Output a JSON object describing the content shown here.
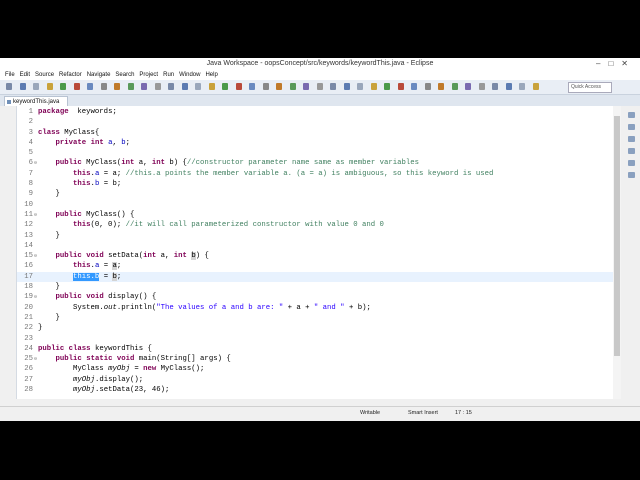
{
  "window": {
    "title": "Java Workspace - oopsConcept/src/keywords/keywordThis.java - Eclipse"
  },
  "menu": [
    "File",
    "Edit",
    "Source",
    "Refactor",
    "Navigate",
    "Search",
    "Project",
    "Run",
    "Window",
    "Help"
  ],
  "toolbar": {
    "quick_access": "Quick Access"
  },
  "editor_tab": {
    "label": "keywordThis.java"
  },
  "code": [
    {
      "n": "1",
      "fold": false,
      "current": false,
      "segs": [
        [
          "kw",
          "package"
        ],
        [
          "",
          "  keywords;"
        ]
      ]
    },
    {
      "n": "2",
      "fold": false,
      "current": false,
      "segs": []
    },
    {
      "n": "3",
      "fold": false,
      "current": false,
      "segs": [
        [
          "kw",
          "class"
        ],
        [
          "",
          " MyClass{"
        ]
      ]
    },
    {
      "n": "4",
      "fold": false,
      "current": false,
      "segs": [
        [
          "",
          "    "
        ],
        [
          "kw",
          "private"
        ],
        [
          "",
          " "
        ],
        [
          "kw",
          "int"
        ],
        [
          "",
          " "
        ],
        [
          "fld",
          "a"
        ],
        [
          ", "
        ],
        [
          "fld",
          "b"
        ],
        [
          ";"
        ]
      ]
    },
    {
      "n": "5",
      "fold": false,
      "current": false,
      "segs": []
    },
    {
      "n": "6",
      "fold": true,
      "current": false,
      "segs": [
        [
          "",
          "    "
        ],
        [
          "kw",
          "public"
        ],
        [
          "",
          " MyClass("
        ],
        [
          "kw",
          "int"
        ],
        [
          "",
          " a, "
        ],
        [
          "kw",
          "int"
        ],
        [
          "",
          " b) {"
        ],
        [
          "cm",
          "//constructor parameter name same as member variables"
        ]
      ]
    },
    {
      "n": "7",
      "fold": false,
      "current": false,
      "segs": [
        [
          "",
          "        "
        ],
        [
          "kw",
          "this"
        ],
        [
          "",
          "."
        ],
        [
          "fld",
          "a"
        ],
        [
          "",
          " = a; "
        ],
        [
          "cm",
          "//this.a points the member variable a. (a = a) is ambiguous, so this keyword is used"
        ]
      ]
    },
    {
      "n": "8",
      "fold": false,
      "current": false,
      "segs": [
        [
          "",
          "        "
        ],
        [
          "kw",
          "this"
        ],
        [
          "",
          "."
        ],
        [
          "fld",
          "b"
        ],
        [
          "",
          " = b;"
        ]
      ]
    },
    {
      "n": "9",
      "fold": false,
      "current": false,
      "segs": [
        [
          "",
          "    }"
        ]
      ]
    },
    {
      "n": "10",
      "fold": false,
      "current": false,
      "segs": []
    },
    {
      "n": "11",
      "fold": true,
      "current": false,
      "segs": [
        [
          "",
          "    "
        ],
        [
          "kw",
          "public"
        ],
        [
          "",
          " MyClass() {"
        ]
      ]
    },
    {
      "n": "12",
      "fold": false,
      "current": false,
      "segs": [
        [
          "",
          "        "
        ],
        [
          "kw",
          "this"
        ],
        [
          "",
          "(0, 0); "
        ],
        [
          "cm",
          "//it will call parameterized constructor with value 0 and 0"
        ]
      ]
    },
    {
      "n": "13",
      "fold": false,
      "current": false,
      "segs": [
        [
          "",
          "    }"
        ]
      ]
    },
    {
      "n": "14",
      "fold": false,
      "current": false,
      "segs": []
    },
    {
      "n": "15",
      "fold": true,
      "current": false,
      "segs": [
        [
          "",
          "    "
        ],
        [
          "kw",
          "public"
        ],
        [
          "",
          " "
        ],
        [
          "kw",
          "void"
        ],
        [
          "",
          " setData("
        ],
        [
          "kw",
          "int"
        ],
        [
          "",
          " a, "
        ],
        [
          "kw",
          "int"
        ],
        [
          "",
          " "
        ],
        [
          "occ",
          "b"
        ],
        [
          "",
          ") {"
        ]
      ]
    },
    {
      "n": "16",
      "fold": false,
      "current": false,
      "segs": [
        [
          "",
          "        "
        ],
        [
          "kw",
          "this"
        ],
        [
          "",
          "."
        ],
        [
          "fld",
          "a"
        ],
        [
          "",
          " = "
        ],
        [
          "occ",
          "a"
        ],
        [
          "",
          ";"
        ]
      ]
    },
    {
      "n": "17",
      "fold": false,
      "current": true,
      "segs": [
        [
          "",
          "        "
        ],
        [
          "sel",
          "this.b"
        ],
        [
          "",
          " = "
        ],
        [
          "occ",
          "b"
        ],
        [
          "",
          ";"
        ]
      ]
    },
    {
      "n": "18",
      "fold": false,
      "current": false,
      "segs": [
        [
          "",
          "    }"
        ]
      ]
    },
    {
      "n": "19",
      "fold": true,
      "current": false,
      "segs": [
        [
          "",
          "    "
        ],
        [
          "kw",
          "public"
        ],
        [
          "",
          " "
        ],
        [
          "kw",
          "void"
        ],
        [
          "",
          " display() {"
        ]
      ]
    },
    {
      "n": "20",
      "fold": false,
      "current": false,
      "segs": [
        [
          "",
          "        System."
        ],
        [
          "it",
          "out"
        ],
        [
          "",
          ".println("
        ],
        [
          "str",
          "\"The values of a and b are: \""
        ],
        [
          "",
          " + a + "
        ],
        [
          "str",
          "\" and \""
        ],
        [
          "",
          " + b);"
        ]
      ]
    },
    {
      "n": "21",
      "fold": false,
      "current": false,
      "segs": [
        [
          "",
          "    }"
        ]
      ]
    },
    {
      "n": "22",
      "fold": false,
      "current": false,
      "segs": [
        [
          "",
          "}"
        ]
      ]
    },
    {
      "n": "23",
      "fold": false,
      "current": false,
      "segs": []
    },
    {
      "n": "24",
      "fold": false,
      "current": false,
      "segs": [
        [
          "kw",
          "public"
        ],
        [
          "",
          " "
        ],
        [
          "kw",
          "class"
        ],
        [
          "",
          " keywordThis {"
        ]
      ]
    },
    {
      "n": "25",
      "fold": true,
      "current": false,
      "segs": [
        [
          "",
          "    "
        ],
        [
          "kw",
          "public"
        ],
        [
          "",
          " "
        ],
        [
          "kw",
          "static"
        ],
        [
          "",
          " "
        ],
        [
          "kw",
          "void"
        ],
        [
          "",
          " main(String[] args) {"
        ]
      ]
    },
    {
      "n": "26",
      "fold": false,
      "current": false,
      "segs": [
        [
          "",
          "        MyClass "
        ],
        [
          "it",
          "myObj"
        ],
        [
          "",
          " = "
        ],
        [
          "kw",
          "new"
        ],
        [
          "",
          " MyClass();"
        ]
      ]
    },
    {
      "n": "27",
      "fold": false,
      "current": false,
      "segs": [
        [
          "",
          "        "
        ],
        [
          "it",
          "myObj"
        ],
        [
          "",
          ".display();"
        ]
      ]
    },
    {
      "n": "28",
      "fold": false,
      "current": false,
      "segs": [
        [
          "",
          "        "
        ],
        [
          "it",
          "myObj"
        ],
        [
          "",
          ".setData(23, 46);"
        ]
      ]
    }
  ],
  "status": {
    "mode": "Writable",
    "insert": "Smart Insert",
    "position": "17 : 15"
  }
}
